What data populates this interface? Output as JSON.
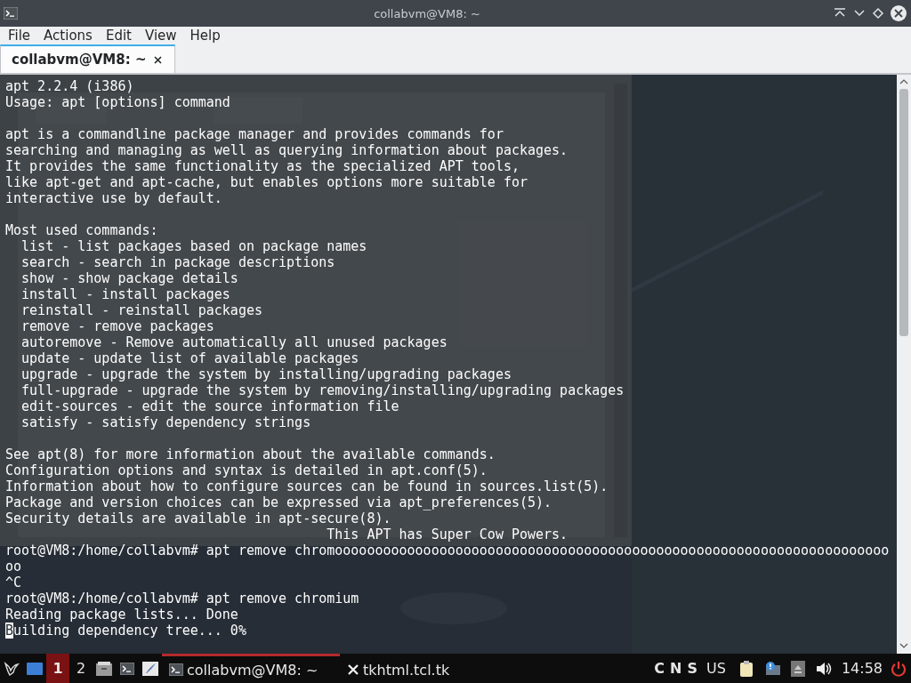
{
  "window": {
    "title": "collabvm@VM8: ~"
  },
  "menu": [
    "File",
    "Actions",
    "Edit",
    "View",
    "Help"
  ],
  "tabs": [
    {
      "label": "collabvm@VM8: ~",
      "selected": true
    }
  ],
  "terminal": {
    "blocks": [
      [
        "apt 2.2.4 (i386)",
        "Usage: apt [options] command"
      ],
      [
        "apt is a commandline package manager and provides commands for",
        "searching and managing as well as querying information about packages.",
        "It provides the same functionality as the specialized APT tools,",
        "like apt-get and apt-cache, but enables options more suitable for",
        "interactive use by default."
      ],
      [
        "Most used commands:",
        "  list - list packages based on package names",
        "  search - search in package descriptions",
        "  show - show package details",
        "  install - install packages",
        "  reinstall - reinstall packages",
        "  remove - remove packages",
        "  autoremove - Remove automatically all unused packages",
        "  update - update list of available packages",
        "  upgrade - upgrade the system by installing/upgrading packages",
        "  full-upgrade - upgrade the system by removing/installing/upgrading packages",
        "  edit-sources - edit the source information file",
        "  satisfy - satisfy dependency strings"
      ],
      [
        "See apt(8) for more information about the available commands.",
        "Configuration options and syntax is detailed in apt.conf(5).",
        "Information about how to configure sources can be found in sources.list(5).",
        "Package and version choices can be expressed via apt_preferences(5).",
        "Security details are available in apt-secure(8).",
        "                                        This APT has Super Cow Powers.",
        "root@VM8:/home/collabvm# apt remove chromooooooooooooooooooooooooooooooooooooooooooooooooooooooooooooooooooooo",
        "oo",
        "^C",
        "root@VM8:/home/collabvm# apt remove chromium",
        "Reading package lists... Done"
      ]
    ],
    "status_line": {
      "text": "Building dependency tree... 0%",
      "cursor": true
    }
  },
  "taskbar": {
    "workspaces": [
      {
        "label": "1",
        "selected": true
      },
      {
        "label": "2",
        "selected": false
      }
    ],
    "tasks": [
      {
        "label": "collabvm@VM8: ~",
        "kind": "terminal",
        "selected": true
      },
      {
        "label": "tkhtml.tcl.tk",
        "kind": "browser",
        "selected": false
      }
    ],
    "indicators": [
      "C",
      "N",
      "S"
    ],
    "layout": "US",
    "clock": "14:58"
  }
}
